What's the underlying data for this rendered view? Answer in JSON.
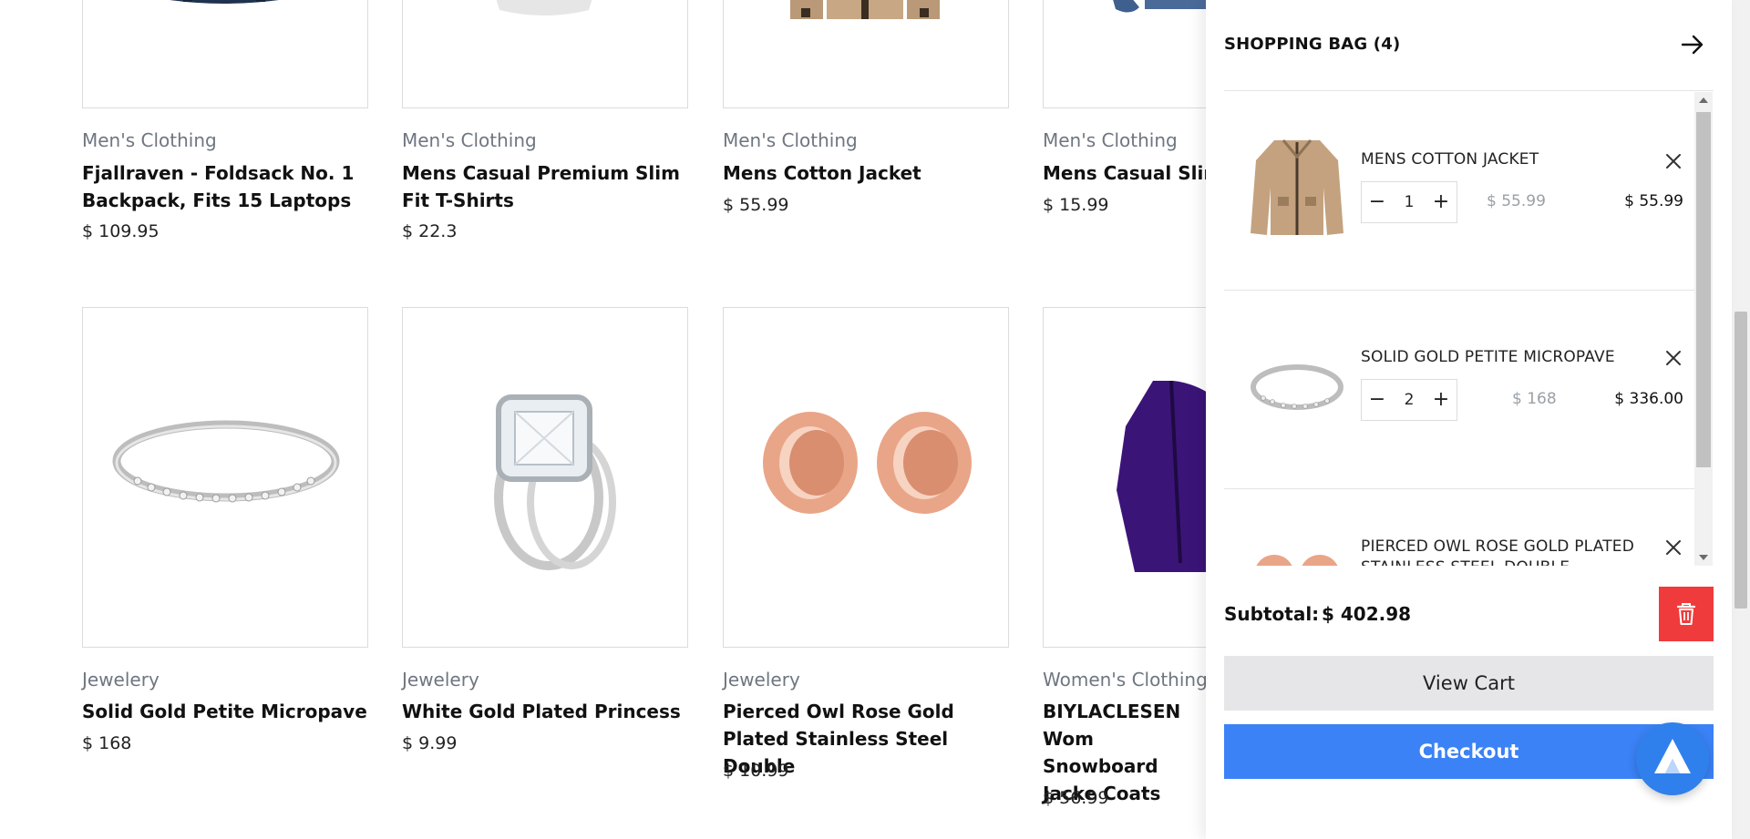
{
  "products": [
    {
      "category": "Men's Clothing",
      "title": "Fjallraven - Foldsack No. 1 Backpack, Fits 15 Laptops",
      "price": "$ 109.95",
      "image": "backpack"
    },
    {
      "category": "Men's Clothing",
      "title": "Mens Casual Premium Slim Fit T-Shirts",
      "price": "$ 22.3",
      "image": "tshirt"
    },
    {
      "category": "Men's Clothing",
      "title": "Mens Cotton Jacket",
      "price": "$ 55.99",
      "image": "jacket"
    },
    {
      "category": "Men's Clothing",
      "title": "Mens Casual Slim",
      "price": "$ 15.99",
      "image": "shirt"
    },
    {
      "category": "Jewelery",
      "title": "Solid Gold Petite Micropave",
      "price": "$ 168",
      "image": "ring"
    },
    {
      "category": "Jewelery",
      "title": "White Gold Plated Princess",
      "price": "$ 9.99",
      "image": "engagement-ring"
    },
    {
      "category": "Jewelery",
      "title": "Pierced Owl Rose Gold Plated Stainless Steel Double",
      "price": "$ 10.99",
      "image": "rose-gold-plugs"
    },
    {
      "category": "Women's Clothing",
      "title": "BIYLACLESEN Wom Snowboard Jacke Coats",
      "price": "$ 56.99",
      "image": "purple-jacket"
    }
  ],
  "cart": {
    "title": "SHOPPING BAG (4)",
    "items": [
      {
        "name": "MENS COTTON JACKET",
        "qty": "1",
        "unit_price": "$ 55.99",
        "line_total": "$ 55.99",
        "image": "jacket"
      },
      {
        "name": "SOLID GOLD PETITE MICROPAVE",
        "qty": "2",
        "unit_price": "$ 168",
        "line_total": "$ 336.00",
        "image": "ring"
      },
      {
        "name": "PIERCED OWL ROSE GOLD PLATED",
        "name2": "STAINLESS STEEL DOUBLE",
        "image": "rose-gold-plugs"
      }
    ],
    "subtotal_label": "Subtotal:",
    "subtotal_value": "$ 402.98",
    "view_cart_label": "View Cart",
    "checkout_label": "Checkout",
    "qty_minus": "−",
    "qty_plus": "+"
  },
  "colors": {
    "accent": "#3b82f6",
    "danger": "#ef3b3b",
    "category_text": "#6f7680"
  },
  "icons": {
    "close_drawer": "arrow-right-icon",
    "remove_item": "close-icon",
    "clear_cart": "trash-icon",
    "assistant": "assistant-logo-icon"
  }
}
